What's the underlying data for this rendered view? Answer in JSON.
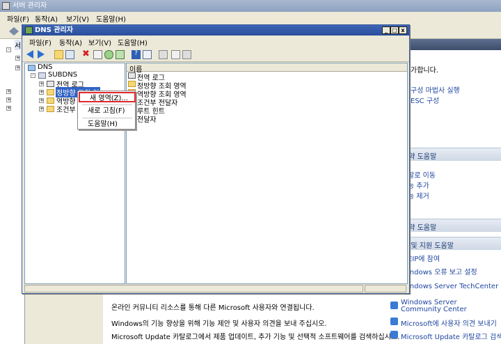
{
  "server_manager": {
    "title": "서버 관리자",
    "menu": [
      "파일(F)",
      "동작(A)",
      "보기(V)",
      "도움말(H)"
    ],
    "right_panel": {
      "intro_text": "가합니다.",
      "links_top": [
        "구성 마법사 실행",
        "ESC 구성"
      ],
      "sections": [
        "요약 도움말",
        "요약 도움말",
        "스 및 지원 도움말"
      ],
      "links_features": [
        "할로 이동",
        "능 추가",
        "능 제거"
      ],
      "links_support": [
        "EIP에 참여",
        "indows 오류 보고 설정",
        "indows Server TechCenter"
      ],
      "bottom_rows": [
        {
          "text": "온라인 커뮤니티 리소스를 통해 다른 Microsoft 사용자와 연결됩니다.",
          "link": "Windows Server Community Center"
        },
        {
          "text": "Windows의 기능 향상을 위해 기능 제안 및 사용자 의견을 보내 주십시오.",
          "link": "Microsoft에 사용자 의견 보내기"
        },
        {
          "text": "Microsoft Update 카탈로그에서 제품 업데이트, 추가 기능 및 선택적 소프트웨어를 검색하십시오.",
          "link": "Microsoft Update 카탈로그 검색"
        }
      ],
      "left_tree_label": "서"
    }
  },
  "dns_manager": {
    "title": "DNS 관리자",
    "menu": [
      "파일(F)",
      "동작(A)",
      "보기(V)",
      "도움말(H)"
    ],
    "tree": {
      "root": "DNS",
      "server": "SUBDNS",
      "children": [
        "전역 로그",
        "정방향 조회 영역",
        "역방향",
        "조건부"
      ]
    },
    "list_header": "이름",
    "list_items": [
      "전역 로그",
      "정방향 조회 영역",
      "역방향 조회 영역",
      "조건부 전달자",
      "루트 힌트",
      "전달자"
    ]
  },
  "context_menu": {
    "items": [
      "새 영역(Z)...",
      "새로 고침(F)",
      "도움말(H)"
    ]
  },
  "colors": {
    "selection_outline": "#e0282c",
    "title_bar": "#2a4f9b",
    "link": "#1f46a0"
  }
}
